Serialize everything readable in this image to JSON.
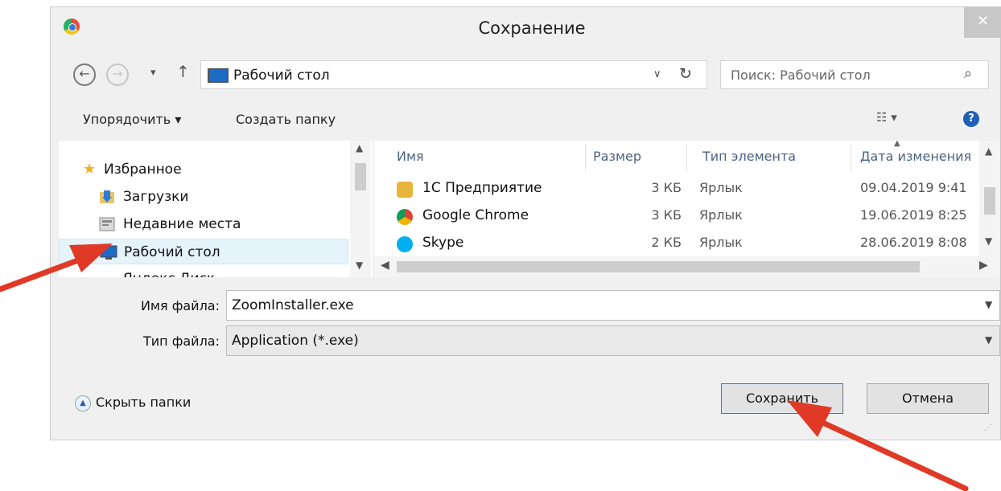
{
  "dialog": {
    "title": "Сохранение",
    "close_glyph": "✕"
  },
  "nav": {
    "back_glyph": "←",
    "forward_glyph": "→",
    "recent_glyph": "▾",
    "up_glyph": "↑",
    "address": "Рабочий стол",
    "address_dropdown_glyph": "∨",
    "refresh_glyph": "↻",
    "search_placeholder": "Поиск: Рабочий стол",
    "search_glyph": "⌕"
  },
  "toolbar": {
    "organize_label": "Упорядочить ▾",
    "new_folder_label": "Создать папку",
    "view_glyph": "☷ ▾",
    "help_glyph": "?"
  },
  "tree": {
    "items": [
      {
        "label": "Избранное",
        "icon": "star-icon"
      },
      {
        "label": "Загрузки",
        "icon": "downloads-folder-icon"
      },
      {
        "label": "Недавние места",
        "icon": "recent-places-icon"
      },
      {
        "label": "Рабочий стол",
        "icon": "desktop-icon",
        "selected": true
      },
      {
        "label": "Яндекс.Диск",
        "icon": "cloud-icon"
      }
    ]
  },
  "files": {
    "columns": [
      "Имя",
      "Размер",
      "Тип элемента",
      "Дата изменения"
    ],
    "rows": [
      {
        "name": "1С Предприятие",
        "size": "3 КБ",
        "type": "Ярлык",
        "date": "09.04.2019 9:41",
        "icon_color": "#e8b43a"
      },
      {
        "name": "Google Chrome",
        "size": "3 КБ",
        "type": "Ярлык",
        "date": "19.06.2019 8:25",
        "icon_color": "#db4437"
      },
      {
        "name": "Skype",
        "size": "2 КБ",
        "type": "Ярлык",
        "date": "28.06.2019 8:08",
        "icon_color": "#00aff0"
      }
    ]
  },
  "fields": {
    "filename_label": "Имя файла:",
    "filename_value": "ZoomInstaller.exe",
    "filetype_label": "Тип файла:",
    "filetype_value": "Application (*.exe)"
  },
  "footer": {
    "hide_folders_label": "Скрыть папки",
    "save_label": "Сохранить",
    "cancel_label": "Отмена"
  },
  "colors": {
    "arrow": "#e03a26",
    "selection": "#e5f3fb"
  }
}
